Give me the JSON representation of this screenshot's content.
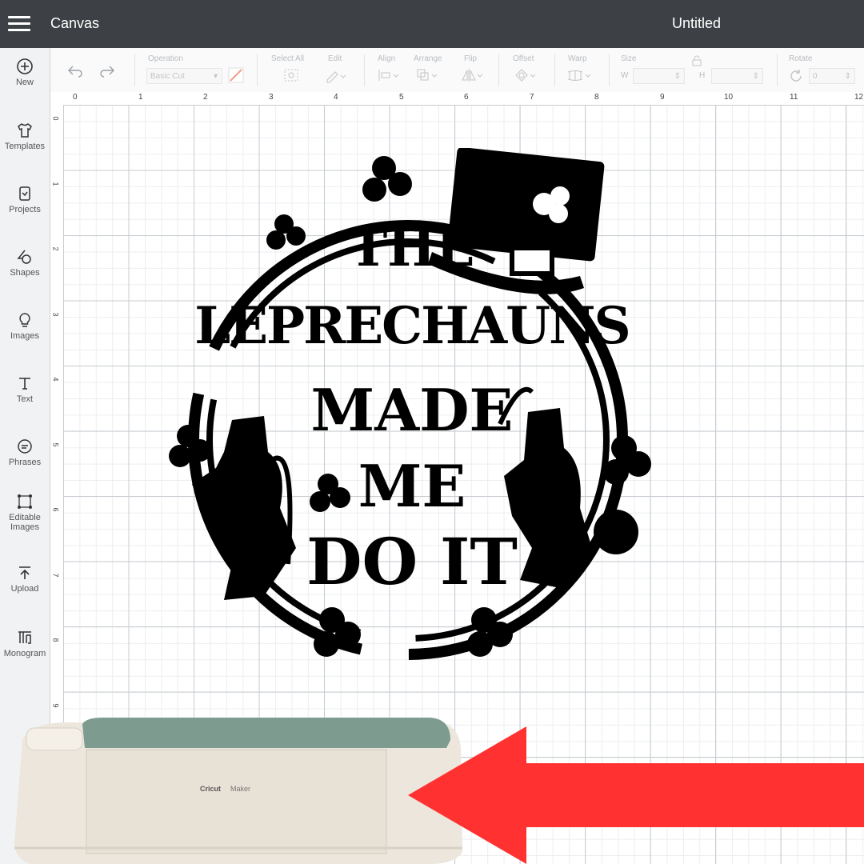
{
  "header": {
    "app_title": "Canvas",
    "document_title": "Untitled"
  },
  "sidebar": {
    "items": [
      {
        "label": "New",
        "icon": "plus-circle-icon"
      },
      {
        "label": "Templates",
        "icon": "shirt-icon"
      },
      {
        "label": "Projects",
        "icon": "projects-icon"
      },
      {
        "label": "Shapes",
        "icon": "shapes-icon"
      },
      {
        "label": "Images",
        "icon": "lightbulb-icon"
      },
      {
        "label": "Text",
        "icon": "text-icon"
      },
      {
        "label": "Phrases",
        "icon": "speech-bubble-icon"
      },
      {
        "label": "Editable Images",
        "icon": "editable-images-icon"
      },
      {
        "label": "Upload",
        "icon": "upload-icon"
      },
      {
        "label": "Monogram",
        "icon": "monogram-icon"
      }
    ]
  },
  "toolbar": {
    "operation_label": "Operation",
    "operation_value": "Basic Cut",
    "select_all_label": "Select All",
    "edit_label": "Edit",
    "align_label": "Align",
    "arrange_label": "Arrange",
    "flip_label": "Flip",
    "offset_label": "Offset",
    "warp_label": "Warp",
    "size_label": "Size",
    "width_label": "W",
    "height_label": "H",
    "rotate_label": "Rotate",
    "rotate_value": "0"
  },
  "rulers": {
    "horizontal": [
      "0",
      "1",
      "2",
      "3",
      "4",
      "5",
      "6",
      "7",
      "8",
      "9",
      "10",
      "11",
      "12"
    ],
    "vertical": [
      "0",
      "1",
      "2",
      "3",
      "4",
      "5",
      "6",
      "7",
      "8",
      "9"
    ]
  },
  "design": {
    "lines": [
      "THE",
      "LEPRECHAUNS",
      "MADE",
      "ME",
      "DO IT"
    ]
  },
  "machine": {
    "brand": "Cricut",
    "model": "Maker"
  },
  "colors": {
    "topbar": "#3d4145",
    "arrow": "#ff3131",
    "machine_body": "#ece6dc",
    "machine_lid": "#7d9b8e"
  }
}
